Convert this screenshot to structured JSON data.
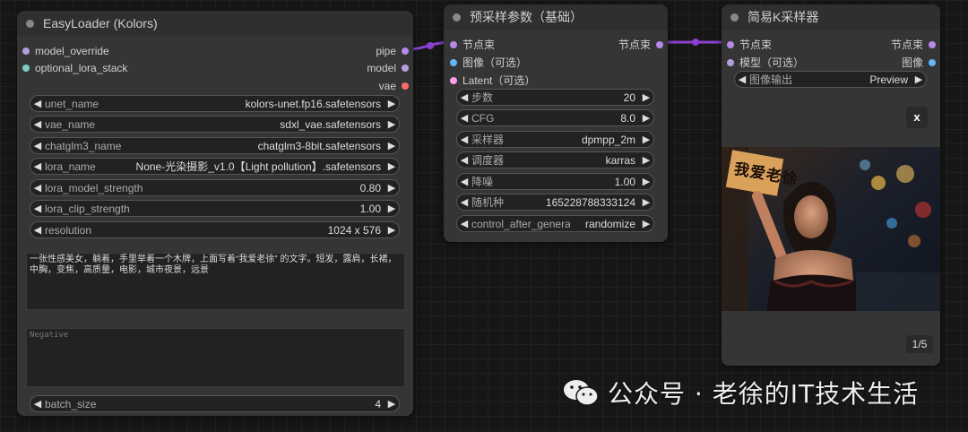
{
  "colors": {
    "accent_purple": "#8a3fcf",
    "pipe": "#b48ae6",
    "model": "#b39ddb",
    "vae": "#ff6b6b",
    "latent": "#ff9ee8",
    "image": "#64b5f6",
    "lora": "#80cbc4"
  },
  "easyloader": {
    "title": "EasyLoader (Kolors)",
    "inputs": [
      "model_override",
      "optional_lora_stack"
    ],
    "outputs": [
      "pipe",
      "model",
      "vae"
    ],
    "widgets": [
      {
        "label": "unet_name",
        "value": "kolors-unet.fp16.safetensors"
      },
      {
        "label": "vae_name",
        "value": "sdxl_vae.safetensors"
      },
      {
        "label": "chatglm3_name",
        "value": "chatglm3-8bit.safetensors"
      },
      {
        "label": "lora_name",
        "value": "None-光染摄影_v1.0【Light pollution】.safetensors"
      },
      {
        "label": "lora_model_strength",
        "value": "0.80"
      },
      {
        "label": "lora_clip_strength",
        "value": "1.00"
      },
      {
        "label": "resolution",
        "value": "1024 x 576"
      }
    ],
    "positive_prompt": "一张性感美女，躺着，手里举着一个木牌，上面写着“我爱老徐” 的文字。短发，露肩，长裙，中胸，变焦，高质量，电影，城市夜景，远景",
    "negative_placeholder": "Negative",
    "batch_size": {
      "label": "batch_size",
      "value": "4"
    }
  },
  "presampler": {
    "title": "预采样参数（基础）",
    "inputs": [
      "节点束",
      "图像（可选）",
      "Latent（可选）"
    ],
    "outputs": [
      "节点束"
    ],
    "widgets": [
      {
        "label": "步数",
        "value": "20"
      },
      {
        "label": "CFG",
        "value": "8.0"
      },
      {
        "label": "采样器",
        "value": "dpmpp_2m"
      },
      {
        "label": "调度器",
        "value": "karras"
      },
      {
        "label": "降噪",
        "value": "1.00"
      },
      {
        "label": "随机种",
        "value": "165228788333124"
      },
      {
        "label": "control_after_generate",
        "value": "randomize"
      }
    ]
  },
  "ksampler": {
    "title": "简易K采样器",
    "inputs": [
      "节点束",
      "模型（可选）"
    ],
    "outputs": [
      "节点束",
      "图像"
    ],
    "widgets": [
      {
        "label": "图像输出",
        "value": "Preview"
      }
    ],
    "close_label": "x",
    "image_sign_text": "我爱老徐",
    "pager": "1/5"
  },
  "watermark": {
    "text": "公众号 · 老徐的IT技术生活"
  }
}
